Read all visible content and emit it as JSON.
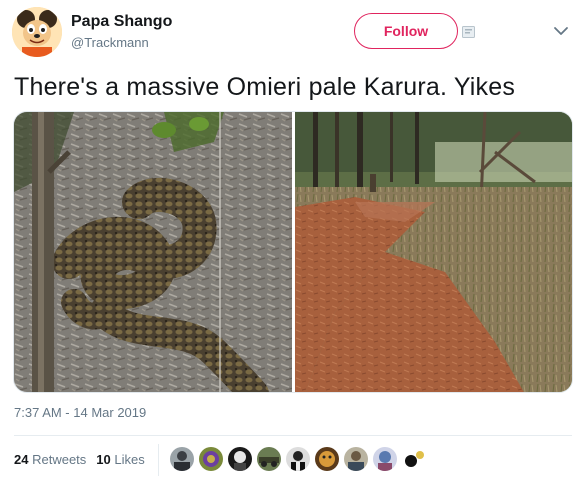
{
  "user": {
    "display_name": "Papa Shango",
    "handle": "@Trackmann"
  },
  "actions": {
    "follow_label": "Follow"
  },
  "tweet": {
    "text": "There's a massive Omieri pale Karura. Yikes",
    "timestamp": "7:37 AM - 14 Mar 2019"
  },
  "stats": {
    "retweets_count": "24",
    "retweets_label": "Retweets",
    "likes_count": "10",
    "likes_label": "Likes"
  },
  "colors": {
    "follow_accent": "#e0245e",
    "muted_text": "#657786",
    "primary_text": "#14171a"
  },
  "media": {
    "photos": [
      "python-coiled-on-leaf-litter",
      "forest-dirt-path"
    ]
  },
  "likers": [
    "liker-avatar",
    "liker-avatar",
    "liker-avatar",
    "liker-avatar",
    "liker-avatar",
    "liker-avatar",
    "liker-avatar",
    "liker-avatar",
    "liker-avatar"
  ]
}
